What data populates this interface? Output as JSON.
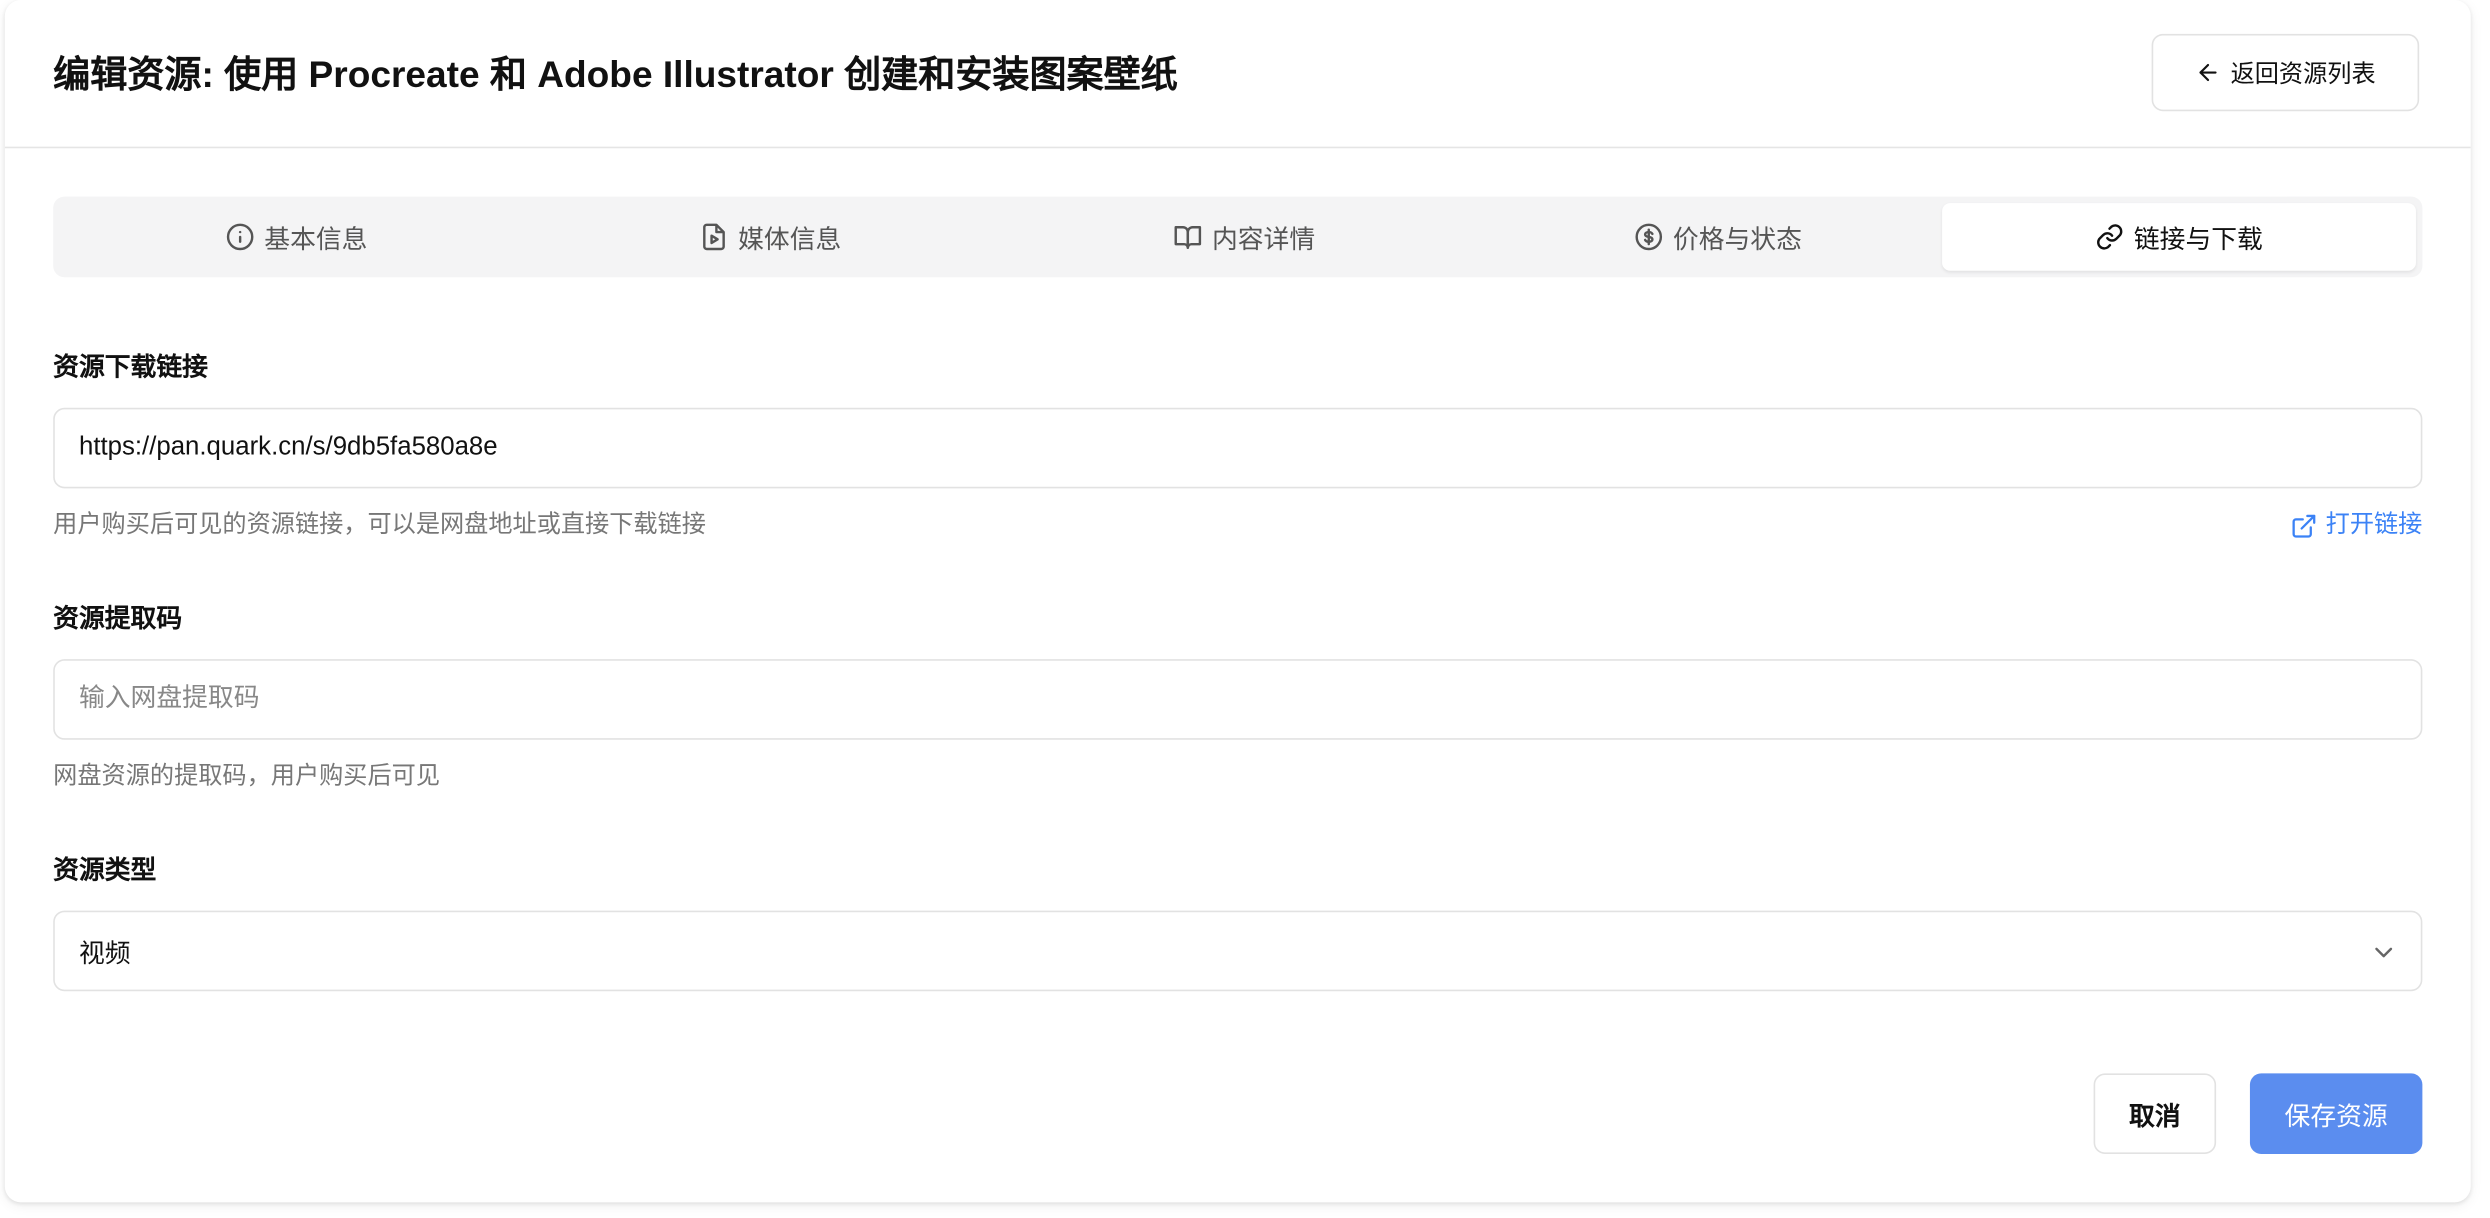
{
  "header": {
    "title": "编辑资源: 使用 Procreate 和 Adobe Illustrator 创建和安装图案壁纸",
    "back_label": "返回资源列表"
  },
  "tabs": [
    {
      "label": "基本信息",
      "icon": "info-icon",
      "active": false
    },
    {
      "label": "媒体信息",
      "icon": "file-video-icon",
      "active": false
    },
    {
      "label": "内容详情",
      "icon": "book-open-icon",
      "active": false
    },
    {
      "label": "价格与状态",
      "icon": "dollar-circle-icon",
      "active": false
    },
    {
      "label": "链接与下载",
      "icon": "link-icon",
      "active": true
    }
  ],
  "form": {
    "download_link": {
      "label": "资源下载链接",
      "value": "https://pan.quark.cn/s/9db5fa580a8e",
      "help": "用户购买后可见的资源链接，可以是网盘地址或直接下载链接",
      "open_link_label": "打开链接"
    },
    "extract_code": {
      "label": "资源提取码",
      "value": "",
      "placeholder": "输入网盘提取码",
      "help": "网盘资源的提取码，用户购买后可见"
    },
    "resource_type": {
      "label": "资源类型",
      "selected": "视频"
    }
  },
  "actions": {
    "cancel_label": "取消",
    "save_label": "保存资源"
  },
  "colors": {
    "accent": "#3b82f6",
    "save_button": "#5b8def",
    "tab_bar_bg": "#f4f4f5"
  }
}
